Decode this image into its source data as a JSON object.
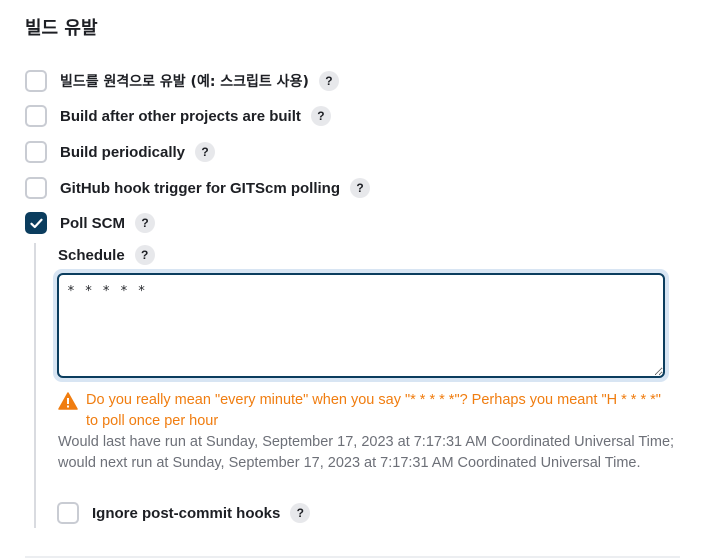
{
  "section": {
    "title": "빌드 유발"
  },
  "triggers": [
    {
      "label": "빌드를 원격으로 유발 (예: 스크립트 사용)",
      "checked": false
    },
    {
      "label": "Build after other projects are built",
      "checked": false
    },
    {
      "label": "Build periodically",
      "checked": false
    },
    {
      "label": "GitHub hook trigger for GITScm polling",
      "checked": false
    },
    {
      "label": "Poll SCM",
      "checked": true
    }
  ],
  "help_glyph": "?",
  "schedule": {
    "label": "Schedule",
    "value": "* * * * *",
    "warning": "Do you really mean \"every minute\" when you say \"* * * * *\"? Perhaps you meant \"H * * * *\" to poll once per hour",
    "last_run": "Would last have run at Sunday, September 17, 2023 at 7:17:31 AM Coordinated Universal Time;",
    "next_run": "would next run at Sunday, September 17, 2023 at 7:17:31 AM Coordinated Universal Time."
  },
  "ignore_post_commit": {
    "label": "Ignore post-commit hooks",
    "checked": false
  },
  "colors": {
    "accent": "#0b3d5e",
    "warning": "#f07d10",
    "muted_text": "#6d7078",
    "help_bg": "#e7e8eb"
  },
  "icons": {
    "checkmark": "checkmark-icon",
    "warning": "warning-triangle-icon",
    "help": "help-icon"
  }
}
